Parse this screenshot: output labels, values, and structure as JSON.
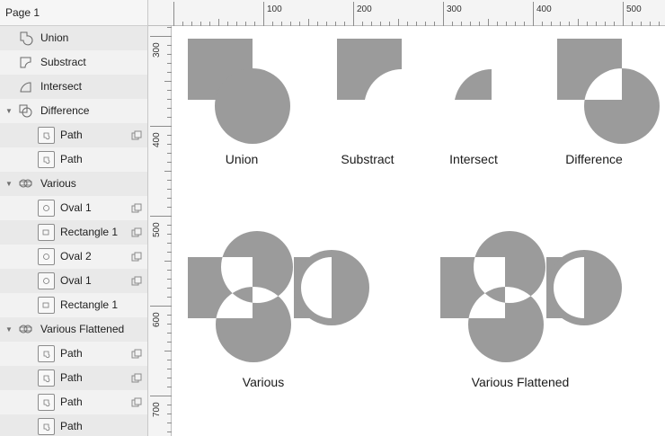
{
  "sidebar": {
    "page_title": "Page 1",
    "layers": [
      {
        "label": "Union",
        "indent": 0,
        "icon": "union-shape-icon",
        "disclosure": ""
      },
      {
        "label": "Substract",
        "indent": 0,
        "icon": "subtract-shape-icon",
        "disclosure": ""
      },
      {
        "label": "Intersect",
        "indent": 0,
        "icon": "intersect-shape-icon",
        "disclosure": ""
      },
      {
        "label": "Difference",
        "indent": 0,
        "icon": "difference-group-icon",
        "disclosure": "▼"
      },
      {
        "label": "Path",
        "indent": 1,
        "icon": "path-thumbnail-icon",
        "bool_op": "difference-op-icon",
        "disclosure": ""
      },
      {
        "label": "Path",
        "indent": 1,
        "icon": "path-thumbnail-icon",
        "bool_op": "",
        "disclosure": ""
      },
      {
        "label": "Various",
        "indent": 0,
        "icon": "combined-group-icon",
        "disclosure": "▼"
      },
      {
        "label": "Oval 1",
        "indent": 1,
        "icon": "oval-thumbnail-icon",
        "bool_op": "difference-op-icon",
        "disclosure": ""
      },
      {
        "label": "Rectangle 1",
        "indent": 1,
        "icon": "rectangle-thumbnail-icon",
        "bool_op": "difference-op-icon",
        "disclosure": ""
      },
      {
        "label": "Oval 2",
        "indent": 1,
        "icon": "oval-thumbnail-icon",
        "bool_op": "difference-op-icon",
        "disclosure": ""
      },
      {
        "label": "Oval 1",
        "indent": 1,
        "icon": "oval-thumbnail-icon",
        "bool_op": "difference-op-icon",
        "disclosure": ""
      },
      {
        "label": "Rectangle 1",
        "indent": 1,
        "icon": "rectangle-thumbnail-icon",
        "bool_op": "",
        "disclosure": ""
      },
      {
        "label": "Various Flattened",
        "indent": 0,
        "icon": "combined-group-icon",
        "disclosure": "▼"
      },
      {
        "label": "Path",
        "indent": 1,
        "icon": "path-thumbnail-icon",
        "bool_op": "difference-op-icon",
        "disclosure": ""
      },
      {
        "label": "Path",
        "indent": 1,
        "icon": "path-thumbnail-icon",
        "bool_op": "difference-op-icon",
        "disclosure": ""
      },
      {
        "label": "Path",
        "indent": 1,
        "icon": "path-thumbnail-icon",
        "bool_op": "difference-op-icon",
        "disclosure": ""
      },
      {
        "label": "Path",
        "indent": 1,
        "icon": "path-thumbnail-icon",
        "bool_op": "",
        "disclosure": ""
      }
    ]
  },
  "rulers": {
    "horizontal_labels": [
      "100",
      "200",
      "300",
      "400",
      "500"
    ],
    "vertical_labels": [
      "300",
      "400",
      "500",
      "600",
      "700"
    ]
  },
  "canvas": {
    "labels": {
      "union": "Union",
      "subtract": "Substract",
      "intersect": "Intersect",
      "difference": "Difference",
      "various": "Various",
      "various_flattened": "Various Flattened"
    },
    "shape_color": "#9b9b9b"
  }
}
